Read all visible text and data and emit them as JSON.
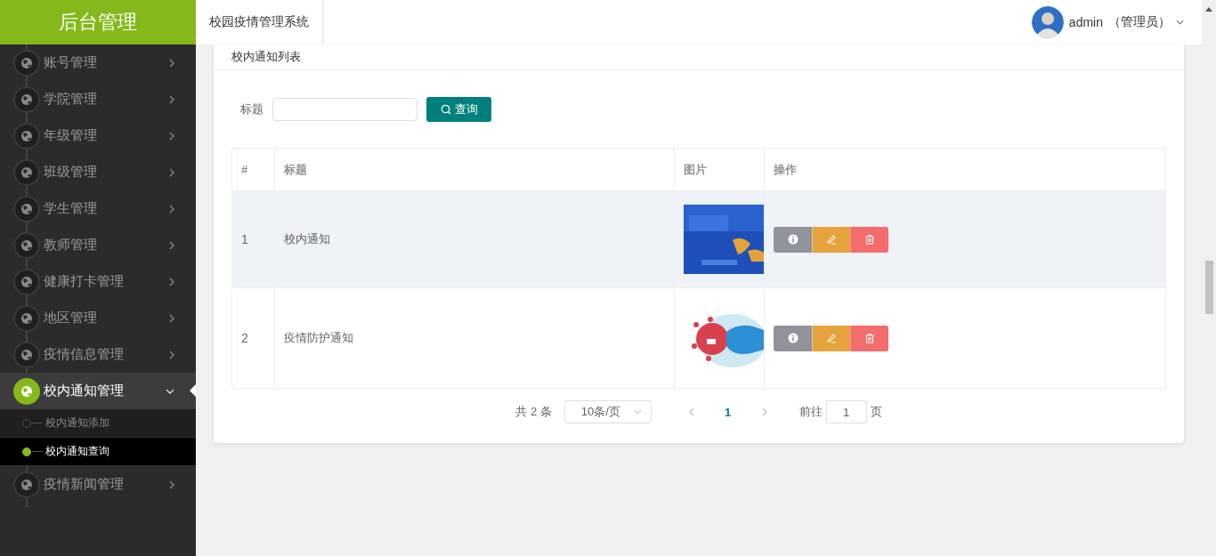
{
  "header": {
    "logo": "后台管理",
    "system_title": "校园疫情管理系统",
    "user": {
      "name": "admin",
      "role": "（管理员）"
    }
  },
  "sidebar": {
    "items": [
      {
        "label": "账号管理",
        "expanded": false
      },
      {
        "label": "学院管理",
        "expanded": false
      },
      {
        "label": "年级管理",
        "expanded": false
      },
      {
        "label": "班级管理",
        "expanded": false
      },
      {
        "label": "学生管理",
        "expanded": false
      },
      {
        "label": "教师管理",
        "expanded": false
      },
      {
        "label": "健康打卡管理",
        "expanded": false
      },
      {
        "label": "地区管理",
        "expanded": false
      },
      {
        "label": "疫情信息管理",
        "expanded": false
      },
      {
        "label": "校内通知管理",
        "expanded": true,
        "children": [
          {
            "label": "校内通知添加",
            "selected": false
          },
          {
            "label": "校内通知查询",
            "selected": true
          }
        ]
      },
      {
        "label": "疫情新闻管理",
        "expanded": false
      }
    ]
  },
  "card": {
    "title": "校内通知列表",
    "search": {
      "label": "标题",
      "button": "查询"
    },
    "table": {
      "columns": [
        "#",
        "标题",
        "图片",
        "操作"
      ],
      "rows": [
        {
          "index": "1",
          "title": "校内通知",
          "hovered": true
        },
        {
          "index": "2",
          "title": "疫情防护通知",
          "hovered": false
        }
      ]
    },
    "pagination": {
      "total": "共 2 条",
      "page_size": "10条/页",
      "pages": [
        {
          "label": "1",
          "selected": true
        }
      ],
      "goto_label": "前往",
      "goto_value": "1",
      "goto_suffix": "页"
    }
  }
}
